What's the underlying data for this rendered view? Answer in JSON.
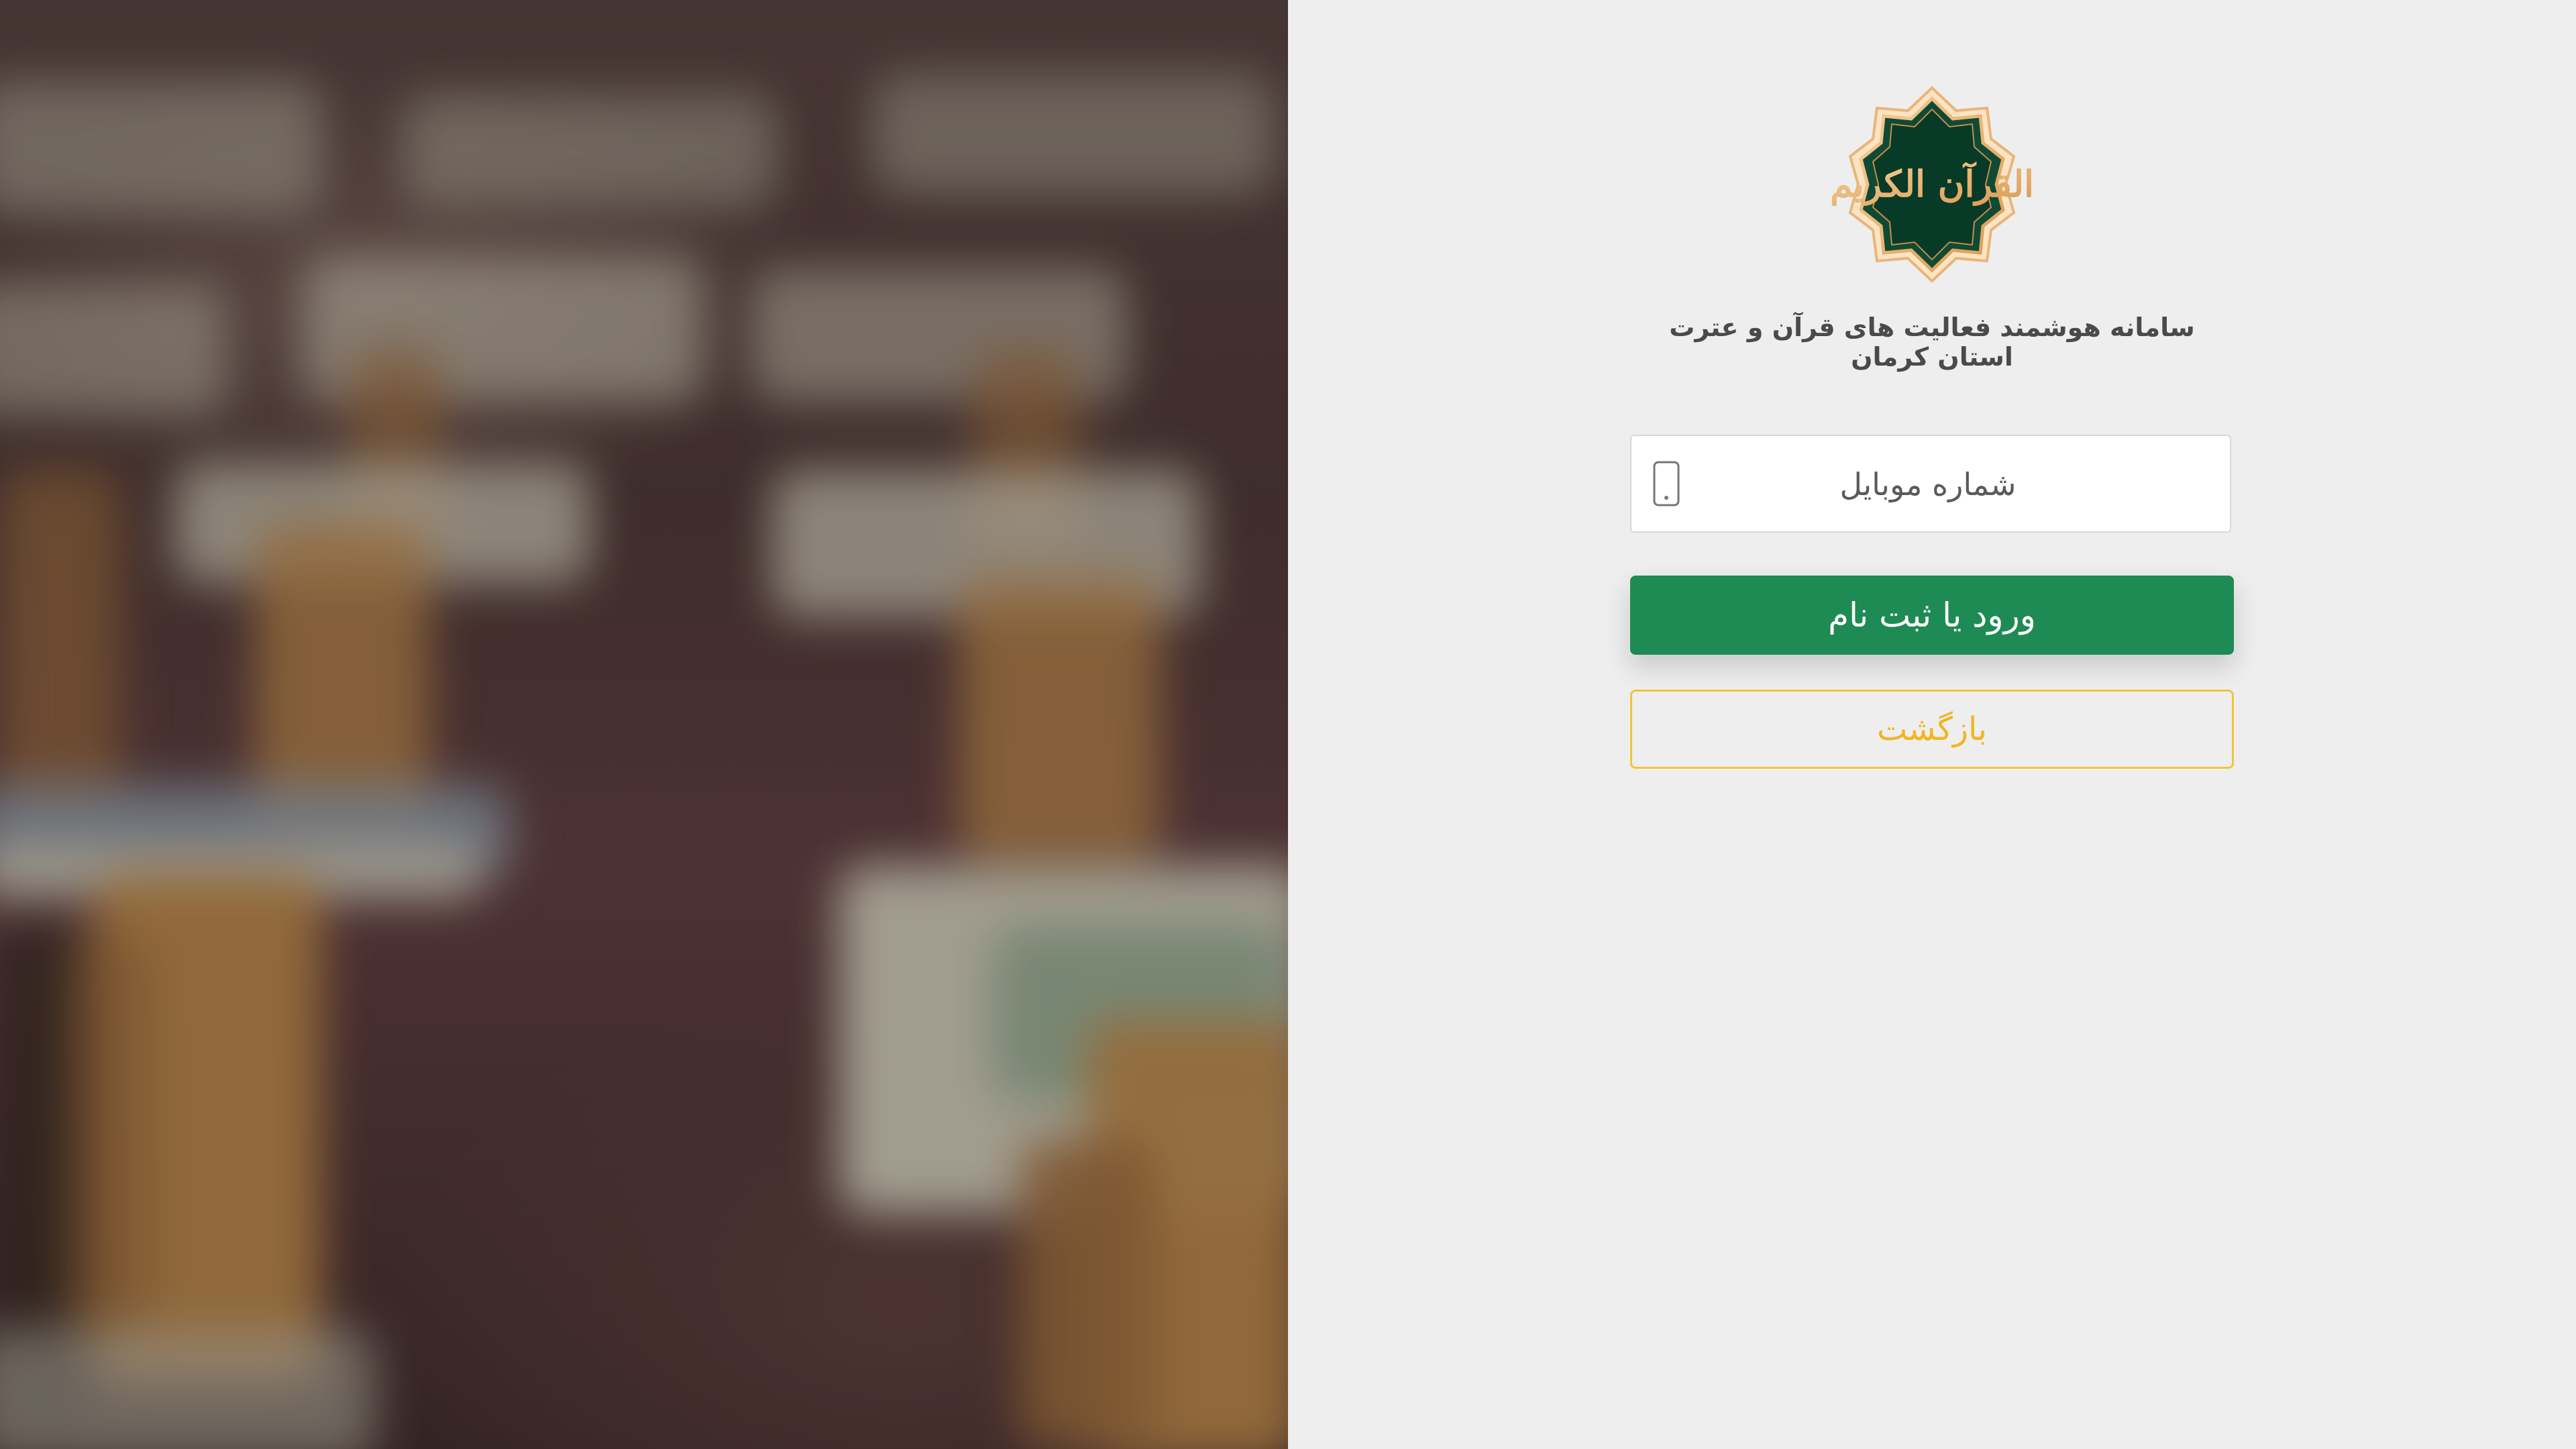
{
  "hero": {
    "description_icon": "quran-rehal-photo"
  },
  "brand": {
    "logo_icon": "quran-emblem-icon",
    "logo_text": "القرآن الكريم",
    "title": "سامانه هوشمند فعالیت های قرآن و عترت استان کرمان",
    "accent_green": "#1e8a54",
    "accent_gold": "#f2b51f"
  },
  "form": {
    "phone_placeholder": "شماره موبایل",
    "phone_value": "",
    "phone_icon": "mobile-phone-icon",
    "submit_label": "ورود یا ثبت نام",
    "back_label": "بازگشت"
  }
}
